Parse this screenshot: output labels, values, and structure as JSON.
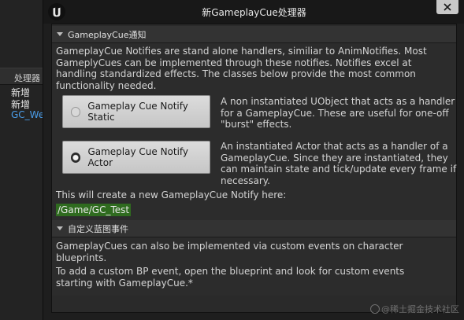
{
  "background_editor": {
    "header_label": "处理器",
    "items": [
      "新增",
      "新增",
      "GC_We"
    ]
  },
  "dialog": {
    "title": "新GameplayCue处理器",
    "close_icon": "close-icon",
    "logo_icon": "unreal-logo-icon"
  },
  "notify_section": {
    "header": "GameplayCue通知",
    "description": "GameplayCue Notifies are stand alone handlers, similiar to AnimNotifies. Most GameplyCues can be implemented through these notifies. Notifies excel at handling standardized effects. The classes below provide the most common functionality needed.",
    "options": [
      {
        "label": "Gameplay Cue Notify Static",
        "selected": false,
        "description": "A non instantiated UObject that acts as a handler for a GameplayCue. These are useful for one-off \"burst\" effects."
      },
      {
        "label": "Gameplay Cue Notify Actor",
        "selected": true,
        "description": "An instantiated Actor that acts as a handler of a GameplayCue. Since they are instantiated, they can maintain state and tick/update every frame if necessary."
      }
    ],
    "create_label": "This will create a new GameplayCue Notify here:",
    "create_path": "/Game/GC_Test"
  },
  "bp_section": {
    "header": "自定义蓝图事件",
    "line1": "GameplayCues can also be implemented via custom events on character blueprints.",
    "line2": "To add a custom BP event, open the blueprint and look for custom events starting with GameplayCue.*"
  },
  "watermark": "@稀土掘金技术社区",
  "colors": {
    "path_highlight": "#2f6b1f",
    "link": "#4a9ce8"
  }
}
